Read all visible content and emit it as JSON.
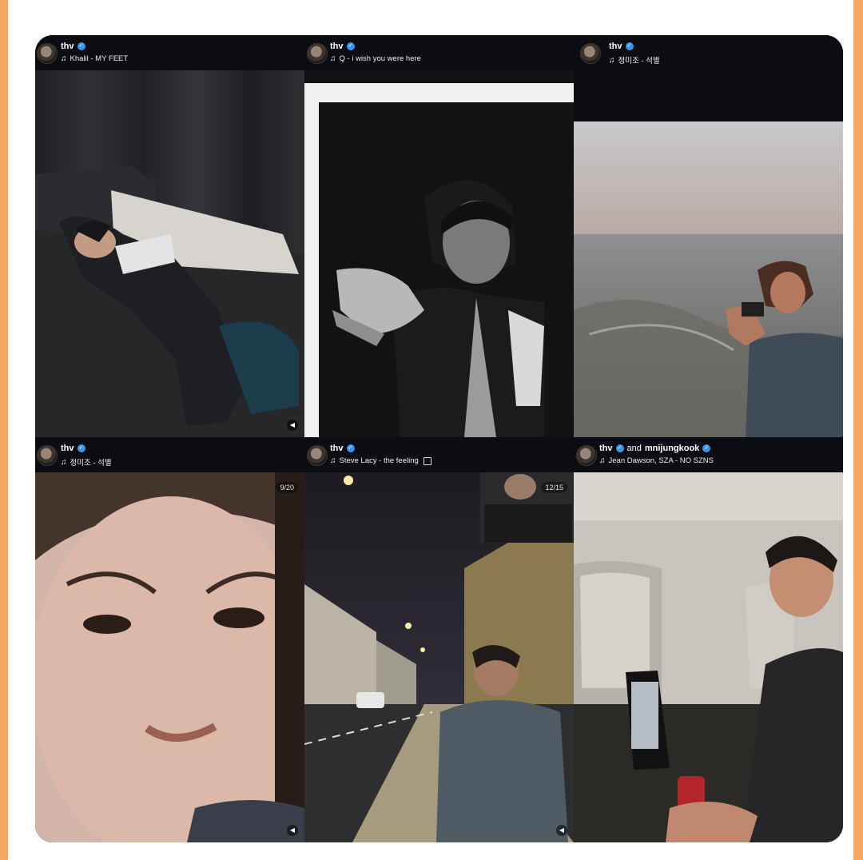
{
  "stories": [
    {
      "username": "thv",
      "music": "Khalil - MY FEET",
      "counter": ""
    },
    {
      "username": "thv",
      "music": "Q - i wish you were here",
      "counter": ""
    },
    {
      "username": "thv",
      "music": "정미조 - 석별",
      "counter": ""
    },
    {
      "username": "thv",
      "music": "정미조 - 석별",
      "counter": "9/20"
    },
    {
      "username": "thv",
      "music": "Steve Lacy - the feeling",
      "counter": "12/15"
    },
    {
      "username": "thv",
      "collab_word": "and",
      "collab_user": "mnijungkook",
      "music": "Jean Dawson, SZA - NO SZNS",
      "counter": ""
    }
  ],
  "icons": {
    "verified": "verified-badge-icon",
    "music": "music-note-icon",
    "menu": "menu-lines-icon",
    "speaker": "speaker-icon"
  },
  "colors": {
    "border": "#f6a862",
    "header_bg": "#0b0d12",
    "verified": "#3797f0"
  }
}
